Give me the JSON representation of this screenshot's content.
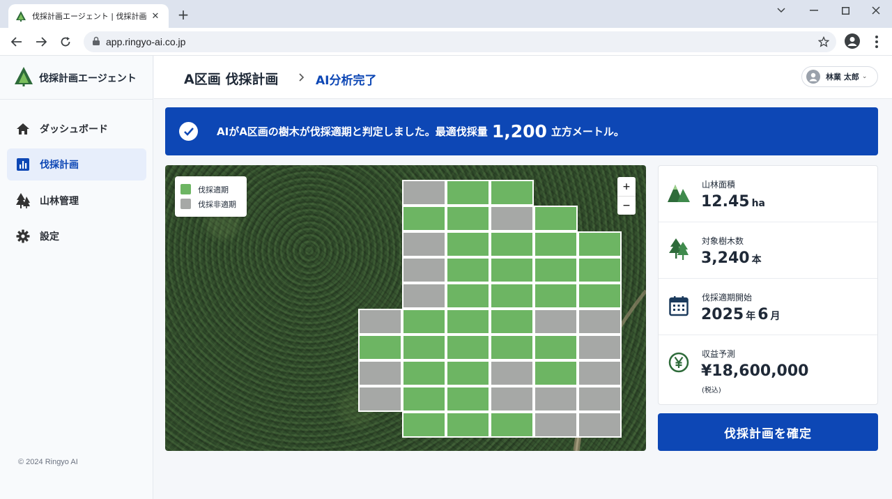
{
  "browser": {
    "tab_title": "伐採計画エージェント | 伐採計画",
    "url": "app.ringyo-ai.co.jp"
  },
  "sidebar": {
    "brand": "伐採計画エージェント",
    "items": [
      {
        "label": "ダッシュボード",
        "icon": "home-icon"
      },
      {
        "label": "伐採計画",
        "icon": "bar-chart-icon",
        "active": true
      },
      {
        "label": "山林管理",
        "icon": "tree-icon"
      },
      {
        "label": "設定",
        "icon": "gear-icon"
      }
    ],
    "copyright": "© 2024 Ringyo AI"
  },
  "header": {
    "title": "A区画 伐採計画",
    "status": "AI分析完了",
    "user": "林業 太郎"
  },
  "banner": {
    "text": "AIがA区画の樹木が伐採適期と判定しました。最適伐採量",
    "volume": "1,200",
    "unit": "立方メートル。"
  },
  "map": {
    "legend": [
      {
        "label": "伐採適期",
        "color": "#6db563"
      },
      {
        "label": "伐採非適期",
        "color": "#a6a8a6"
      }
    ],
    "zoom_in": "+",
    "zoom_out": "−",
    "grid_legend": "H = 伐採適期, N = 伐採非適期, . = 区画外",
    "grid": [
      ". . . N H H . .",
      ". . . H H N H .",
      ". . . N H H H H",
      ". . . N H H H H",
      ". . . N H H H H",
      ". . N H H H N N",
      ". . H H H H H N",
      ". . N H H N H N",
      ". . N H H N N N",
      ". . . H H H N N"
    ]
  },
  "stats": [
    {
      "label": "山林面積",
      "value": "12.45",
      "unit": "ha",
      "icon": "mountain-icon"
    },
    {
      "label": "対象樹木数",
      "value": "3,240",
      "unit": "本",
      "icon": "trees-icon"
    },
    {
      "label": "伐採適期開始",
      "value": "2025",
      "unit": "年",
      "value2": "6",
      "unit2": "月",
      "icon": "calendar-icon"
    },
    {
      "label": "収益予測",
      "value": "¥18,600,000",
      "unit": "",
      "note": "(税込)",
      "icon": "yen-icon"
    }
  ],
  "confirm_button": "伐採計画を確定",
  "colors": {
    "primary": "#0d47b5",
    "harvest": "#6db563",
    "non_harvest": "#a6a8a6",
    "forest_green": "#2e6b3a"
  }
}
